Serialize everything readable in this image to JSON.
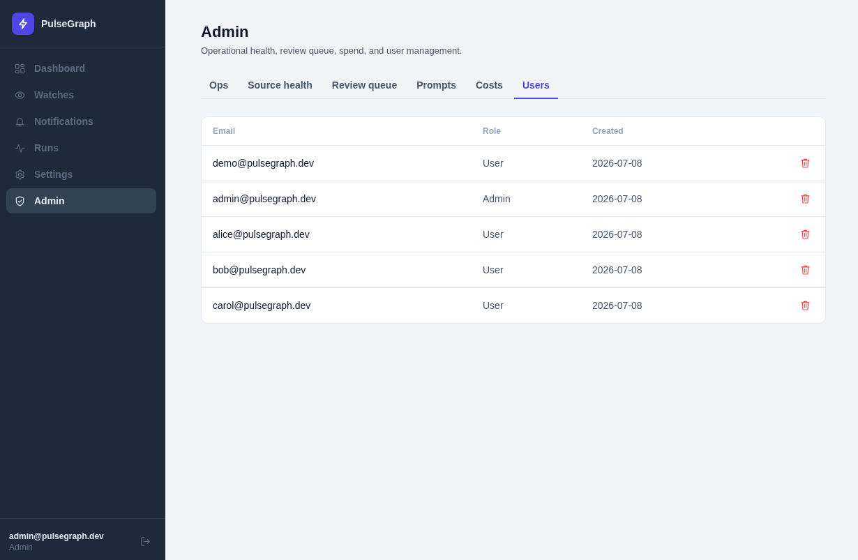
{
  "sidebar": {
    "brand": "PulseGraph",
    "items": [
      {
        "label": "Dashboard",
        "selected": false
      },
      {
        "label": "Watches",
        "selected": false
      },
      {
        "label": "Notifications",
        "selected": false
      },
      {
        "label": "Runs",
        "selected": false
      },
      {
        "label": "Settings",
        "selected": false
      },
      {
        "label": "Admin",
        "selected": true
      }
    ],
    "user": {
      "email": "admin@pulsegraph.dev",
      "role": "Admin"
    }
  },
  "page": {
    "title": "Admin",
    "subtitle": "Operational health, review queue, spend, and user management."
  },
  "tabs": [
    {
      "label": "Ops",
      "selected": false
    },
    {
      "label": "Source health",
      "selected": false
    },
    {
      "label": "Review queue",
      "selected": false
    },
    {
      "label": "Prompts",
      "selected": false
    },
    {
      "label": "Costs",
      "selected": false
    },
    {
      "label": "Users",
      "selected": true
    }
  ],
  "table": {
    "columns": [
      "Email",
      "Role",
      "Created"
    ],
    "rows": [
      {
        "email": "demo@pulsegraph.dev",
        "role": "User",
        "created": "2026-07-08"
      },
      {
        "email": "admin@pulsegraph.dev",
        "role": "Admin",
        "created": "2026-07-08"
      },
      {
        "email": "alice@pulsegraph.dev",
        "role": "User",
        "created": "2026-07-08"
      },
      {
        "email": "bob@pulsegraph.dev",
        "role": "User",
        "created": "2026-07-08"
      },
      {
        "email": "carol@pulsegraph.dev",
        "role": "User",
        "created": "2026-07-08"
      }
    ]
  }
}
